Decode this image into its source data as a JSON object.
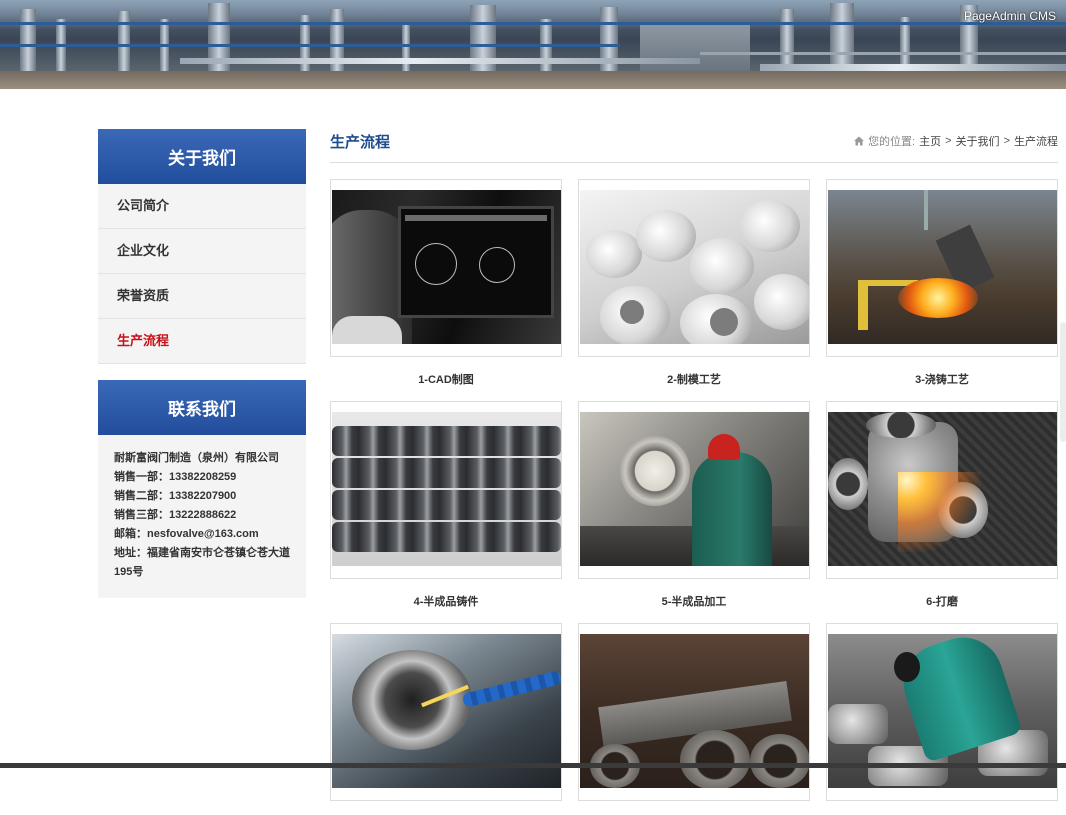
{
  "banner": {
    "cms_label": "PageAdmin CMS"
  },
  "sidebar": {
    "about_title": "关于我们",
    "items": [
      {
        "label": "公司简介",
        "active": false
      },
      {
        "label": "企业文化",
        "active": false
      },
      {
        "label": "荣誉资质",
        "active": false
      },
      {
        "label": "生产流程",
        "active": true
      }
    ],
    "contact_title": "联系我们",
    "contact_lines": [
      "耐斯富阀门制造（泉州）有限公司",
      "销售一部：13382208259",
      "销售二部：13382207900",
      "销售三部：13222888622",
      "邮箱：nesfovalve@163.com",
      "地址：福建省南安市仑苍镇仑苍大道195号"
    ]
  },
  "main": {
    "title": "生产流程",
    "breadcrumb": {
      "prefix": "您的位置:",
      "home": "主页",
      "sep": ">",
      "parent": "关于我们",
      "current": "生产流程"
    },
    "cards": [
      {
        "caption": "1-CAD制图",
        "photo": "cad"
      },
      {
        "caption": "2-制模工艺",
        "photo": "mold"
      },
      {
        "caption": "3-浇铸工艺",
        "photo": "pour"
      },
      {
        "caption": "4-半成品铸件",
        "photo": "semi"
      },
      {
        "caption": "5-半成品加工",
        "photo": "machine"
      },
      {
        "caption": "6-打磨",
        "photo": "grind"
      },
      {
        "caption": "",
        "photo": "lathe"
      },
      {
        "caption": "",
        "photo": "rough"
      },
      {
        "caption": "",
        "photo": "assy"
      }
    ]
  },
  "colors": {
    "accent_blue": "#2c5aa8",
    "title_blue": "#1e4d8c",
    "active_red": "#c4131a"
  },
  "icons": {
    "breadcrumb_home": "home-icon"
  }
}
